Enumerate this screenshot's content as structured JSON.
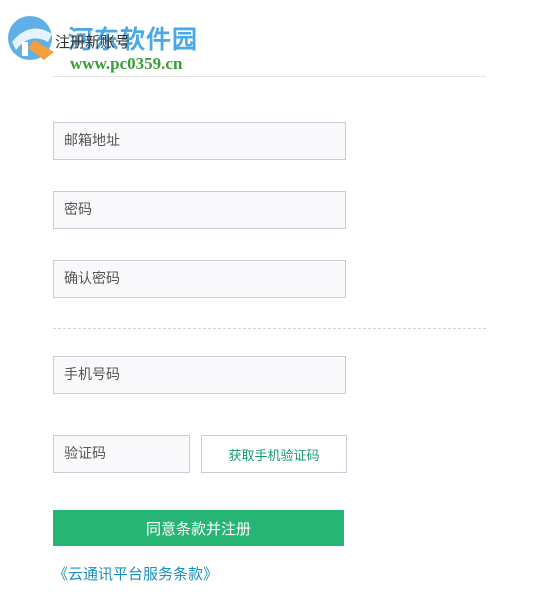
{
  "watermark": {
    "site_name": "河东软件园",
    "site_url": "www.pc0359.cn"
  },
  "page": {
    "title": "注册新账号"
  },
  "form": {
    "email_placeholder": "邮箱地址",
    "password_placeholder": "密码",
    "confirm_password_placeholder": "确认密码",
    "phone_placeholder": "手机号码",
    "code_placeholder": "验证码",
    "get_code_label": "获取手机验证码",
    "submit_label": "同意条款并注册",
    "terms_link": "《云通讯平台服务条款》"
  },
  "colors": {
    "accent_green": "#27b573",
    "link_blue": "#1a8fc2",
    "watermark_blue": "#4aa8e6",
    "watermark_green": "#3a9d3a"
  }
}
